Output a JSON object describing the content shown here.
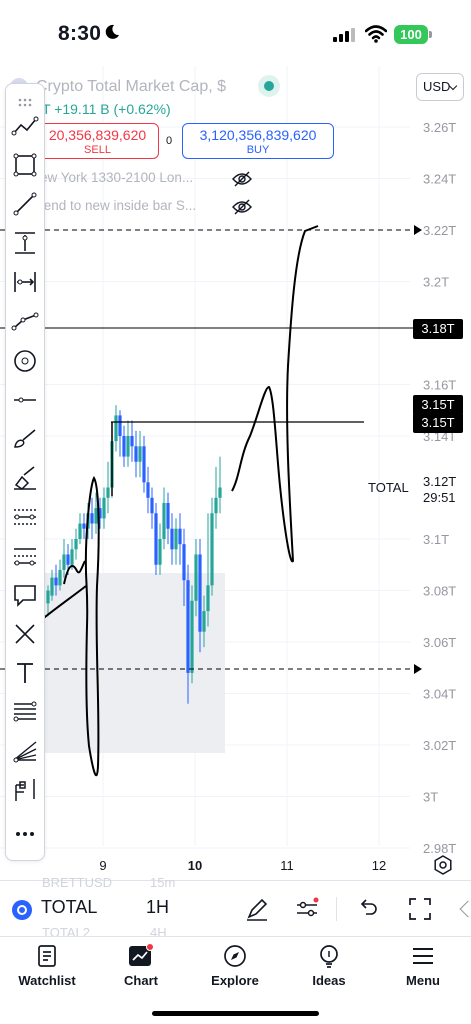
{
  "status_bar": {
    "time": "8:30",
    "battery": "100"
  },
  "header": {
    "symbol_title": "Crypto Total Market Cap, $",
    "change": "T +19.11 B (+0.62%)",
    "currency": "USD",
    "sell_price": "20,356,839,620",
    "sell_label": "SELL",
    "spread": "0",
    "buy_price": "3,120,356,839,620",
    "buy_label": "BUY",
    "indicators": [
      "ew York 1330-2100 Lon...",
      "tend to new inside bar S..."
    ]
  },
  "price_axis": {
    "ticks": [
      "3.26T",
      "3.24T",
      "3.22T",
      "3.2T",
      "3.16T",
      "3.14T",
      "3.1T",
      "3.08T",
      "3.06T",
      "3.04T",
      "3.02T",
      "3T",
      "2.98T"
    ],
    "highlight_labels": [
      "3.18T",
      "3.15T",
      "3.15T"
    ],
    "total_label": "TOTAL",
    "total_price": "3.12T",
    "countdown": "29:51"
  },
  "time_axis": {
    "ticks": [
      "9",
      "10",
      "11",
      "12"
    ]
  },
  "bottom_toolbar": {
    "symbol": "TOTAL",
    "interval": "1H",
    "ghost_symbol": "BRETTUSD",
    "ghost_interval": "15m",
    "ghost_symbol_2": "TOTAL2",
    "ghost_interval_2": "4H"
  },
  "tabs": [
    {
      "label": "Watchlist",
      "icon": "watchlist-icon"
    },
    {
      "label": "Chart",
      "icon": "chart-icon"
    },
    {
      "label": "Explore",
      "icon": "compass-icon"
    },
    {
      "label": "Ideas",
      "icon": "lightbulb-icon"
    },
    {
      "label": "Menu",
      "icon": "menu-icon"
    }
  ],
  "colors": {
    "up": "#26a69a",
    "down": "#2962ff",
    "sell": "#f23645",
    "buy": "#2962ff",
    "ink": "#000000"
  }
}
